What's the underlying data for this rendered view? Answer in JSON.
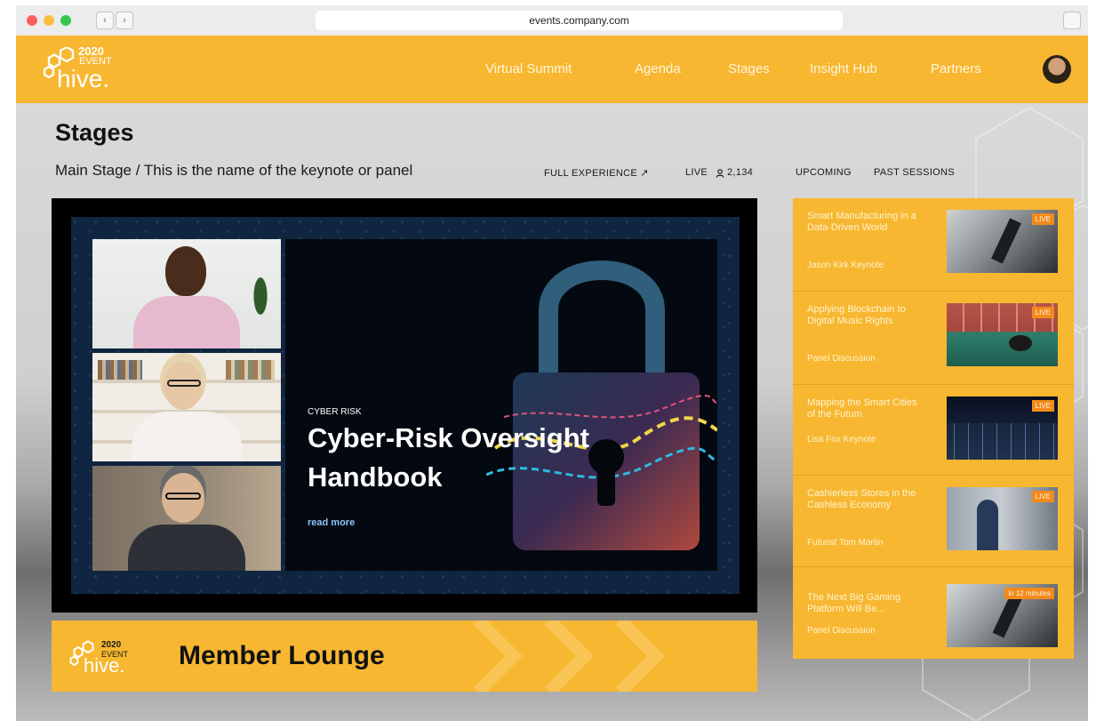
{
  "browser": {
    "url": "events.company.com"
  },
  "brand": {
    "year": "2020",
    "event": "EVENT",
    "name": "hive."
  },
  "nav": [
    {
      "label": "Virtual Summit"
    },
    {
      "label": "Agenda"
    },
    {
      "label": "Stages"
    },
    {
      "label": "Insight Hub"
    },
    {
      "label": "Partners"
    }
  ],
  "page": {
    "title": "Stages",
    "breadcrumb": "Main Stage / This is the name of the keynote or panel",
    "full_experience": "FULL EXPERIENCE ↗",
    "live_label": "LIVE",
    "live_count": "2,134",
    "upcoming": "UPCOMING",
    "past_sessions": "PAST SESSIONS"
  },
  "slide": {
    "kicker": "CYBER RISK",
    "title_line1": "Cyber-Risk Oversight",
    "title_line2": "Handbook",
    "read_more": "read more"
  },
  "lounge": {
    "title": "Member Lounge"
  },
  "sessions": [
    {
      "title": "Smart Manufacturing in a Data-Driven World",
      "subtitle": "Jason Kirk Keynote",
      "badge": "LIVE"
    },
    {
      "title": "Applying Blockchain to Digital Music Rights",
      "subtitle": "Panel Discussion",
      "badge": "LIVE"
    },
    {
      "title": "Mapping the Smart Cities of the Futum",
      "subtitle": "Lisa Fox Keynote",
      "badge": "LIVE"
    },
    {
      "title": "Cashierless Stores in the Cashless Economy",
      "subtitle": "Futurist Tom Martin",
      "badge": "LIVE"
    },
    {
      "title": "The Next Big Gaming Platform Will Be...",
      "subtitle": "Panel Discussion",
      "badge": "in 12 minutes"
    }
  ],
  "colors": {
    "brand_yellow": "#f7b731",
    "badge_orange": "#f28a1b",
    "slide_text": "#ffffff"
  }
}
